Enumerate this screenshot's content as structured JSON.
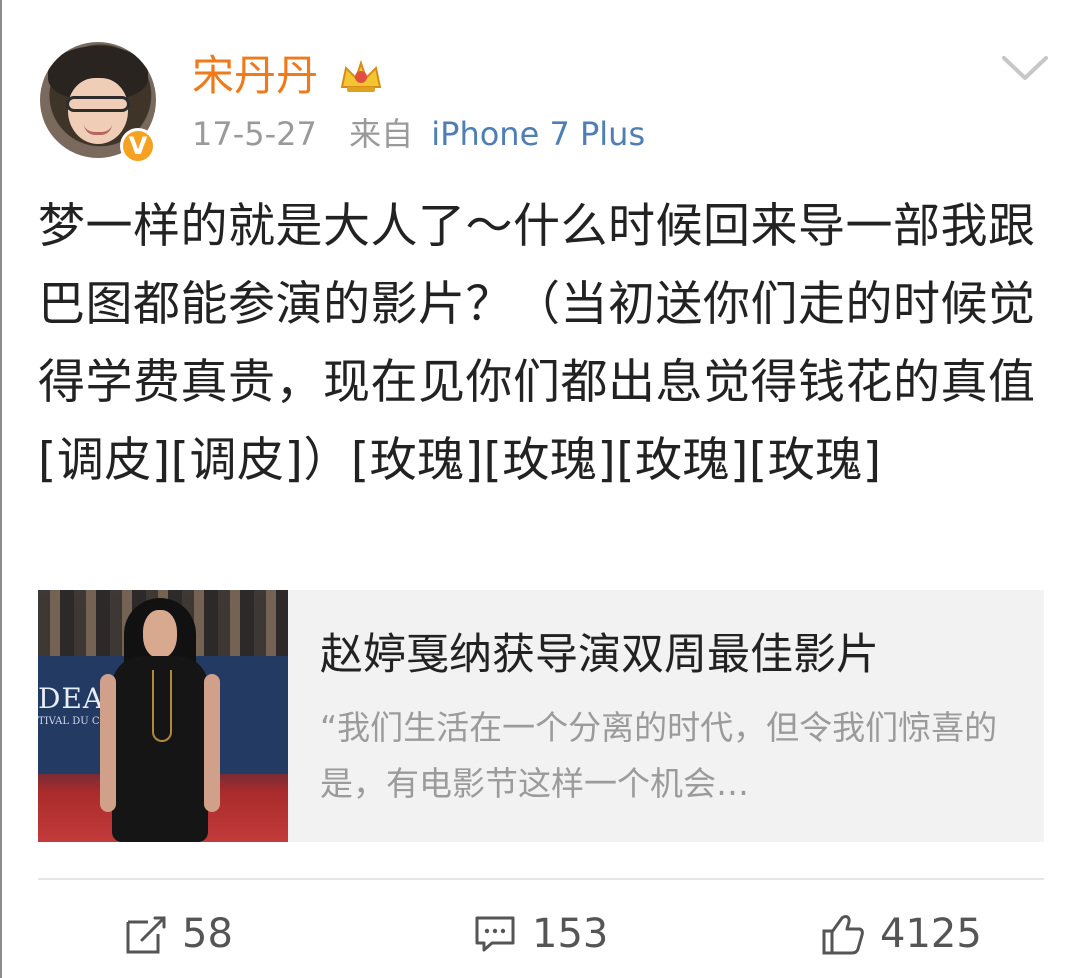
{
  "post": {
    "author": "宋丹丹",
    "date": "17-5-27",
    "source_prefix": "来自",
    "device": "iPhone 7 Plus",
    "text": "梦一样的就是大人了～什么时候回来导一部我跟巴图都能参演的影片？（当初送你们走的时候觉得学费真贵，现在见你们都出息觉得钱花的真值[调皮][调皮]）[玫瑰][玫瑰][玫瑰][玫瑰]"
  },
  "card": {
    "title": "赵婷戛纳获导演双周最佳影片",
    "description": "“我们生活在一个分离的时代，但令我们惊喜的是，有电影节这样一个机会…",
    "thumb_banner": "DEAUV",
    "thumb_banner_sub": "TIVAL DU CINÉ"
  },
  "actions": {
    "reposts": "58",
    "comments": "153",
    "likes": "4125"
  }
}
